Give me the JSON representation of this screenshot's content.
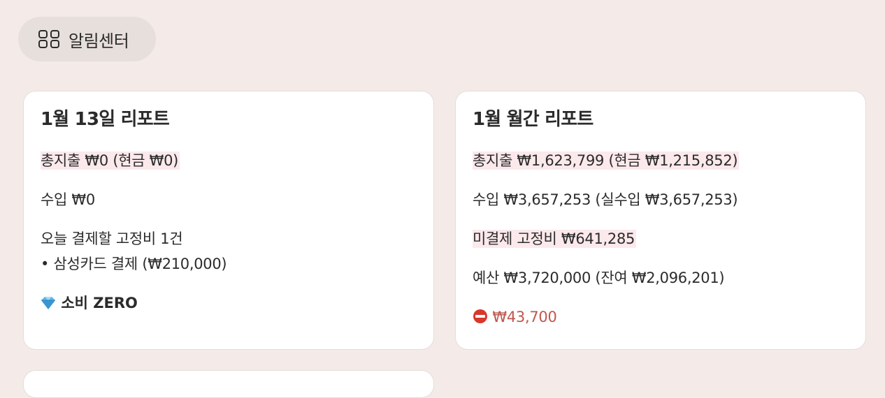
{
  "header": {
    "icon": "grid-icon",
    "title": "알림센터"
  },
  "daily_report": {
    "title": "1월 13일 리포트",
    "total_spend": "총지출 ₩0 (현금 ₩0)",
    "income": "수입 ₩0",
    "fixed_today": "오늘 결제할 고정비 1건",
    "fixed_item": "• 삼성카드 결제 (₩210,000)",
    "zero_icon": "diamond-icon",
    "zero_label": "소비 ZERO"
  },
  "monthly_report": {
    "title": "1월 월간 리포트",
    "total_spend": "총지출 ₩1,623,799 (현금 ₩1,215,852)",
    "income": "수입 ₩3,657,253 (실수입 ₩3,657,253)",
    "unpaid_fixed": "미결제 고정비 ₩641,285",
    "budget": "예산 ₩3,720,000 (잔여 ₩2,096,201)",
    "over_icon": "no-entry-icon",
    "over_amount": "₩43,700"
  },
  "colors": {
    "background": "#f4ebe9",
    "highlight": "#fbe9ec",
    "danger": "#c0574e"
  }
}
